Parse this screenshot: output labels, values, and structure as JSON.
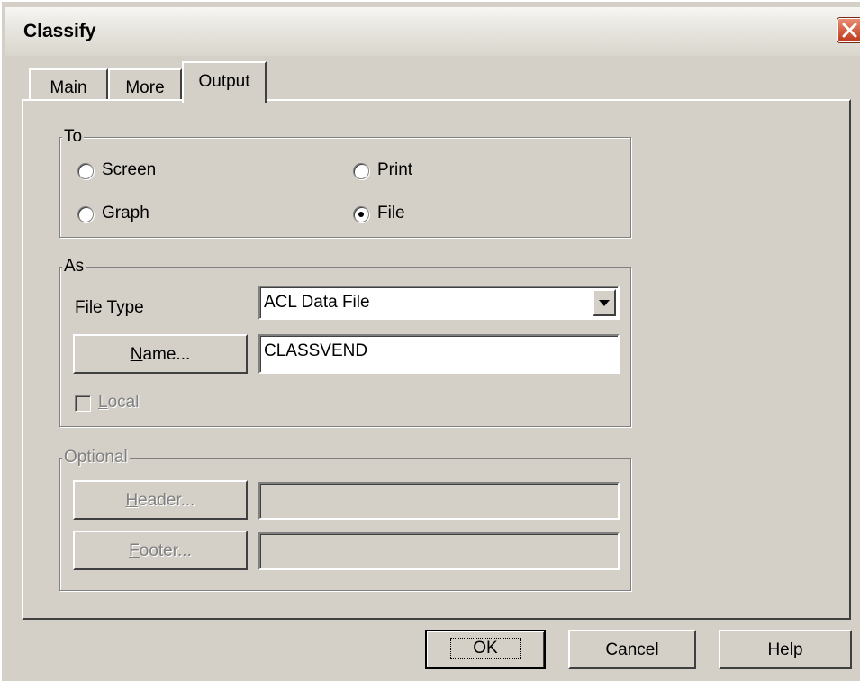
{
  "window": {
    "title": "Classify"
  },
  "tabs": [
    {
      "label": "Main",
      "selected": false
    },
    {
      "label": "More",
      "selected": false
    },
    {
      "label": "Output",
      "selected": true
    }
  ],
  "to_group": {
    "label": "To",
    "options": [
      {
        "label": "Screen",
        "selected": false
      },
      {
        "label": "Print",
        "selected": false
      },
      {
        "label": "Graph",
        "selected": false
      },
      {
        "label": "File",
        "selected": true
      }
    ]
  },
  "as_group": {
    "label": "As",
    "file_type_label": "File Type",
    "file_type_value": "ACL Data File",
    "name_button": {
      "mnemonic": "N",
      "rest": "ame..."
    },
    "name_value": "CLASSVEND",
    "local_checkbox": {
      "mnemonic": "L",
      "rest": "ocal",
      "checked": false,
      "enabled": false
    }
  },
  "optional_group": {
    "label": "Optional",
    "header_button": {
      "mnemonic": "H",
      "rest": "eader..."
    },
    "header_value": "",
    "footer_button": {
      "mnemonic": "F",
      "rest": "ooter..."
    },
    "footer_value": ""
  },
  "buttons": {
    "ok": "OK",
    "cancel": "Cancel",
    "help": "Help"
  }
}
